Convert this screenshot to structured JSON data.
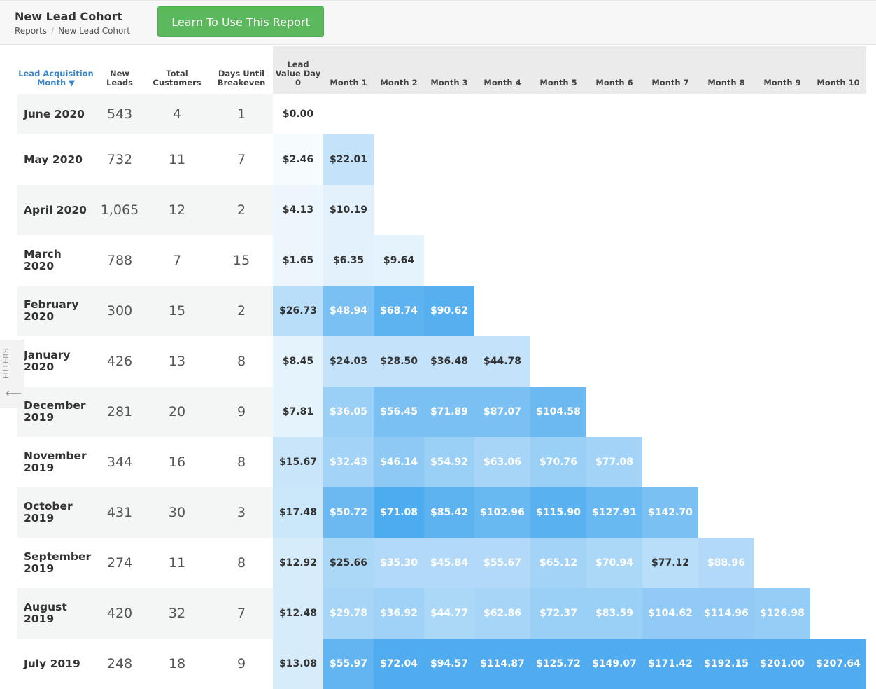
{
  "header": {
    "title": "New Lead Cohort",
    "breadcrumb": [
      "Reports",
      "New Lead Cohort"
    ],
    "learn_button": "Learn To Use This Report"
  },
  "filters_tab": {
    "label": "FILTERS",
    "icon": "arrow-left-icon"
  },
  "table": {
    "columns": [
      {
        "label": "Lead Acquisition Month ▼",
        "sortable": true
      },
      {
        "label": "New Leads"
      },
      {
        "label": "Total Customers"
      },
      {
        "label": "Days Until Breakeven"
      },
      {
        "label": "Lead Value Day 0"
      },
      {
        "label": "Month 1"
      },
      {
        "label": "Month 2"
      },
      {
        "label": "Month 3"
      },
      {
        "label": "Month 4"
      },
      {
        "label": "Month 5"
      },
      {
        "label": "Month 6"
      },
      {
        "label": "Month 7"
      },
      {
        "label": "Month 8"
      },
      {
        "label": "Month 9"
      },
      {
        "label": "Month 10"
      }
    ],
    "rows": [
      {
        "month": "June 2020",
        "new_leads": "543",
        "customers": "4",
        "breakeven": "1",
        "values": [
          "$0.00"
        ],
        "shade": [
          0
        ],
        "light_text": []
      },
      {
        "month": "May 2020",
        "new_leads": "732",
        "customers": "11",
        "breakeven": "7",
        "values": [
          "$2.46",
          "$22.01"
        ],
        "shade": [
          0.05,
          0.32
        ],
        "light_text": []
      },
      {
        "month": "April 2020",
        "new_leads": "1,065",
        "customers": "12",
        "breakeven": "2",
        "values": [
          "$4.13",
          "$10.19"
        ],
        "shade": [
          0.1,
          0.16
        ],
        "light_text": []
      },
      {
        "month": "March 2020",
        "new_leads": "788",
        "customers": "7",
        "breakeven": "15",
        "values": [
          "$1.65",
          "$6.35",
          "$9.64"
        ],
        "shade": [
          0.1,
          0.16,
          0.14
        ],
        "light_text": []
      },
      {
        "month": "February 2020",
        "new_leads": "300",
        "customers": "15",
        "breakeven": "2",
        "values": [
          "$26.73",
          "$48.94",
          "$68.74",
          "$90.62"
        ],
        "shade": [
          0.38,
          0.72,
          0.88,
          0.92
        ],
        "light_text": [
          1,
          2,
          3
        ]
      },
      {
        "month": "January 2020",
        "new_leads": "426",
        "customers": "13",
        "breakeven": "8",
        "values": [
          "$8.45",
          "$24.03",
          "$28.50",
          "$36.48",
          "$44.78"
        ],
        "shade": [
          0.14,
          0.32,
          0.32,
          0.32,
          0.32
        ],
        "light_text": []
      },
      {
        "month": "December 2019",
        "new_leads": "281",
        "customers": "20",
        "breakeven": "9",
        "values": [
          "$7.81",
          "$36.05",
          "$56.45",
          "$71.89",
          "$87.07",
          "$104.58"
        ],
        "shade": [
          0.14,
          0.55,
          0.72,
          0.72,
          0.72,
          0.8
        ],
        "light_text": [
          1,
          2,
          3,
          4,
          5
        ]
      },
      {
        "month": "November 2019",
        "new_leads": "344",
        "customers": "16",
        "breakeven": "8",
        "values": [
          "$15.67",
          "$32.43",
          "$46.14",
          "$54.92",
          "$63.06",
          "$70.76",
          "$77.08"
        ],
        "shade": [
          0.3,
          0.5,
          0.62,
          0.55,
          0.48,
          0.55,
          0.5
        ],
        "light_text": [
          1,
          2,
          3,
          4,
          5,
          6
        ]
      },
      {
        "month": "October 2019",
        "new_leads": "431",
        "customers": "30",
        "breakeven": "3",
        "values": [
          "$17.48",
          "$50.72",
          "$71.08",
          "$85.42",
          "$102.96",
          "$115.90",
          "$127.91",
          "$142.70"
        ],
        "shade": [
          0.28,
          0.8,
          0.97,
          0.88,
          0.82,
          0.9,
          0.82,
          0.72
        ],
        "light_text": [
          1,
          2,
          3,
          4,
          5,
          6,
          7
        ]
      },
      {
        "month": "September 2019",
        "new_leads": "274",
        "customers": "11",
        "breakeven": "8",
        "values": [
          "$12.92",
          "$25.66",
          "$35.30",
          "$45.84",
          "$55.67",
          "$65.12",
          "$70.94",
          "$77.12",
          "$88.96"
        ],
        "shade": [
          0.22,
          0.45,
          0.42,
          0.42,
          0.42,
          0.5,
          0.45,
          0.38,
          0.42
        ],
        "light_text": [
          2,
          3,
          4,
          5,
          6,
          8
        ]
      },
      {
        "month": "August 2019",
        "new_leads": "420",
        "customers": "32",
        "breakeven": "7",
        "values": [
          "$12.48",
          "$29.78",
          "$36.92",
          "$44.77",
          "$62.86",
          "$72.37",
          "$83.59",
          "$104.62",
          "$114.96",
          "$126.98"
        ],
        "shade": [
          0.22,
          0.48,
          0.52,
          0.45,
          0.48,
          0.55,
          0.55,
          0.6,
          0.6,
          0.58
        ],
        "light_text": [
          1,
          2,
          3,
          4,
          5,
          6,
          7,
          8,
          9
        ]
      },
      {
        "month": "July 2019",
        "new_leads": "248",
        "customers": "18",
        "breakeven": "9",
        "values": [
          "$13.08",
          "$55.97",
          "$72.04",
          "$94.57",
          "$114.87",
          "$125.72",
          "$149.07",
          "$171.42",
          "$192.15",
          "$201.00",
          "$207.64"
        ],
        "shade": [
          0.22,
          0.85,
          0.95,
          0.95,
          0.95,
          0.95,
          0.95,
          0.95,
          0.95,
          0.95,
          0.95
        ],
        "light_text": [
          1,
          2,
          3,
          4,
          5,
          6,
          7,
          8,
          9,
          10
        ]
      }
    ]
  },
  "colors": {
    "accent_green": "#5cb85c",
    "heat_low": "#ffffff",
    "heat_high": "#47a8ee",
    "sort_link": "#3a86c8"
  }
}
